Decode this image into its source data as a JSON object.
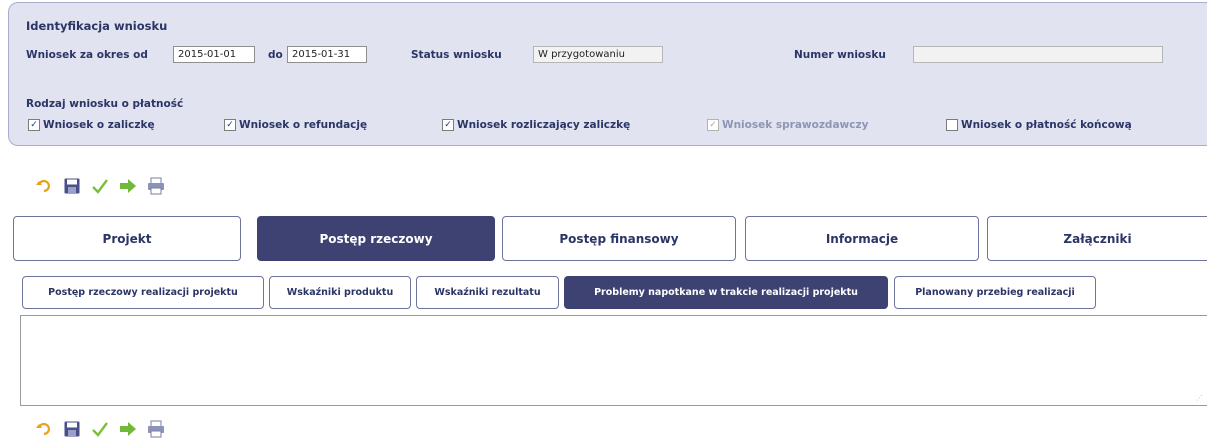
{
  "header": {
    "title": "Identyfikacja wniosku",
    "period_from_label": "Wniosek za okres od",
    "period_from_value": "2015-01-01",
    "period_to_label": "do",
    "period_to_value": "2015-01-31",
    "status_label": "Status wniosku",
    "status_value": "W przygotowaniu",
    "number_label": "Numer wniosku",
    "number_value": "",
    "payment_type_label": "Rodzaj wniosku o płatność",
    "checkboxes": [
      {
        "label": "Wniosek o zaliczkę",
        "checked": true,
        "disabled": false
      },
      {
        "label": "Wniosek o refundację",
        "checked": true,
        "disabled": false
      },
      {
        "label": "Wniosek rozliczający zaliczkę",
        "checked": true,
        "disabled": false
      },
      {
        "label": "Wniosek sprawozdawczy",
        "checked": true,
        "disabled": true
      },
      {
        "label": "Wniosek o płatność końcową",
        "checked": false,
        "disabled": false
      }
    ]
  },
  "toolbar": {
    "icons": [
      "undo-icon",
      "save-icon",
      "check-icon",
      "send-icon",
      "print-icon"
    ]
  },
  "main_tabs": [
    {
      "label": "Projekt",
      "active": false
    },
    {
      "label": "Postęp rzeczowy",
      "active": true
    },
    {
      "label": "Postęp finansowy",
      "active": false
    },
    {
      "label": "Informacje",
      "active": false
    },
    {
      "label": "Załączniki",
      "active": false
    }
  ],
  "sub_tabs": [
    {
      "label": "Postęp rzeczowy realizacji projektu",
      "active": false
    },
    {
      "label": "Wskaźniki produktu",
      "active": false
    },
    {
      "label": "Wskaźniki rezultatu",
      "active": false
    },
    {
      "label": "Problemy napotkane w trakcie realizacji projektu",
      "active": true
    },
    {
      "label": "Planowany przebieg realizacji",
      "active": false
    }
  ],
  "content": {
    "text": ""
  },
  "colors": {
    "panel_bg": "#e1e3f1",
    "active_tab": "#3d4273",
    "label_text": "#2b3566"
  }
}
